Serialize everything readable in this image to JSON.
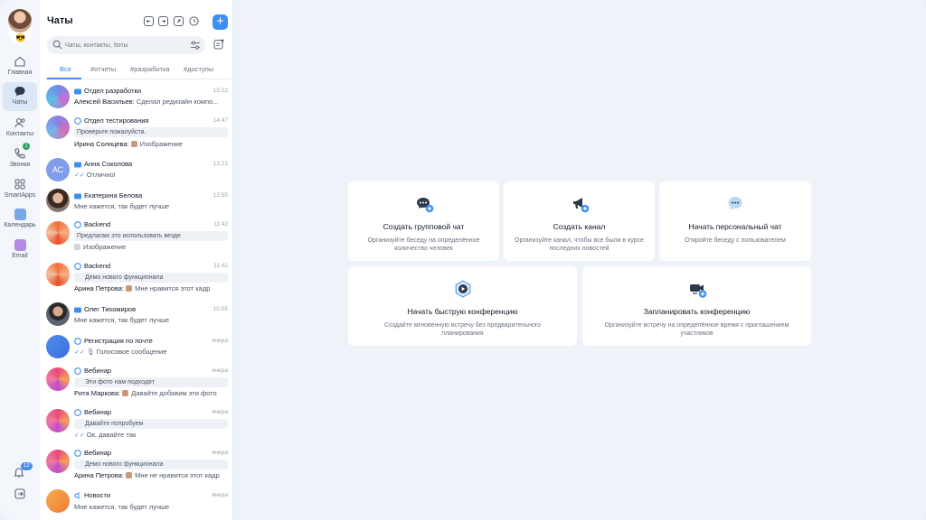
{
  "rail": {
    "emoji": "😎",
    "items": [
      {
        "label": "Главная"
      },
      {
        "label": "Чаты"
      },
      {
        "label": "Контакты"
      },
      {
        "label": "Звонки",
        "badge": "1"
      },
      {
        "label": "SmartApps"
      },
      {
        "label": "Календарь"
      },
      {
        "label": "Email"
      }
    ],
    "notifications_badge": "12"
  },
  "panel": {
    "title": "Чаты",
    "search_placeholder": "Чаты, контакты, боты",
    "tabs": [
      "Все",
      "#отчеты",
      "#разработка",
      "#доступы"
    ],
    "chats": [
      {
        "name": "Отдел разработки",
        "time": "15:22",
        "sender": "Алексей Васильев:",
        "text": "Сделал редизайн компо..."
      },
      {
        "name": "Отдел тестирования",
        "time": "14:47",
        "quote": "Проверьте пожалуйста.",
        "sender": "Ирина Солнцева:",
        "text": "Изображение"
      },
      {
        "name": "Анна Соколова",
        "time": "13:21",
        "initials": "АС",
        "text": "Отлично!"
      },
      {
        "name": "Екатерина Белова",
        "time": "12:55",
        "text": "Мне кажется, так будет лучше"
      },
      {
        "name": "Backend",
        "time": "11:42",
        "quote": "Предлагаю это использовать везде",
        "text": "Изображение"
      },
      {
        "name": "Backend",
        "time": "11:42",
        "quote": "Демо нового функционала",
        "sender": "Арина Петрова:",
        "text": "Мне нравится этот кадр"
      },
      {
        "name": "Олег Тихомиров",
        "time": "10:55",
        "text": "Мне кажется, так будет лучше"
      },
      {
        "name": "Регистрация по почте",
        "time": "вчера",
        "text": "Голосовое сообщение"
      },
      {
        "name": "Вебинар",
        "time": "вчера",
        "quote": "Эти фото нам подходят",
        "sender": "Рита Маркова:",
        "text": "Давайте добавим эти фото"
      },
      {
        "name": "Вебинар",
        "time": "вчера",
        "quote": "Давайте попробуем",
        "text": "Ок, давайте так"
      },
      {
        "name": "Вебинар",
        "time": "вчера",
        "quote": "Демо нового функционала",
        "sender": "Арина Петрова:",
        "text": "Мне не нравится этот кадр"
      },
      {
        "name": "Новости",
        "time": "вчера",
        "text": "Мне кажется, так будет лучше"
      }
    ]
  },
  "cards": [
    {
      "title": "Создать групповой чат",
      "desc": "Организуйте беседу на определённое количество человек"
    },
    {
      "title": "Создать канал",
      "desc": "Организуйте канал, чтобы все были в курсе последних новостей"
    },
    {
      "title": "Начать персональный чат",
      "desc": "Откройте беседу с пользователем"
    },
    {
      "title": "Начать быструю конференцию",
      "desc": "Создайте мгновенную встречу без предварительного планирования"
    },
    {
      "title": "Запланировать конференцию",
      "desc": "Организуйте встречу на определённое время с приглашением участников"
    }
  ],
  "colors": {
    "accent": "#3e8ff0",
    "background": "#eef3fa",
    "active_nav": "#dbe7f6"
  }
}
